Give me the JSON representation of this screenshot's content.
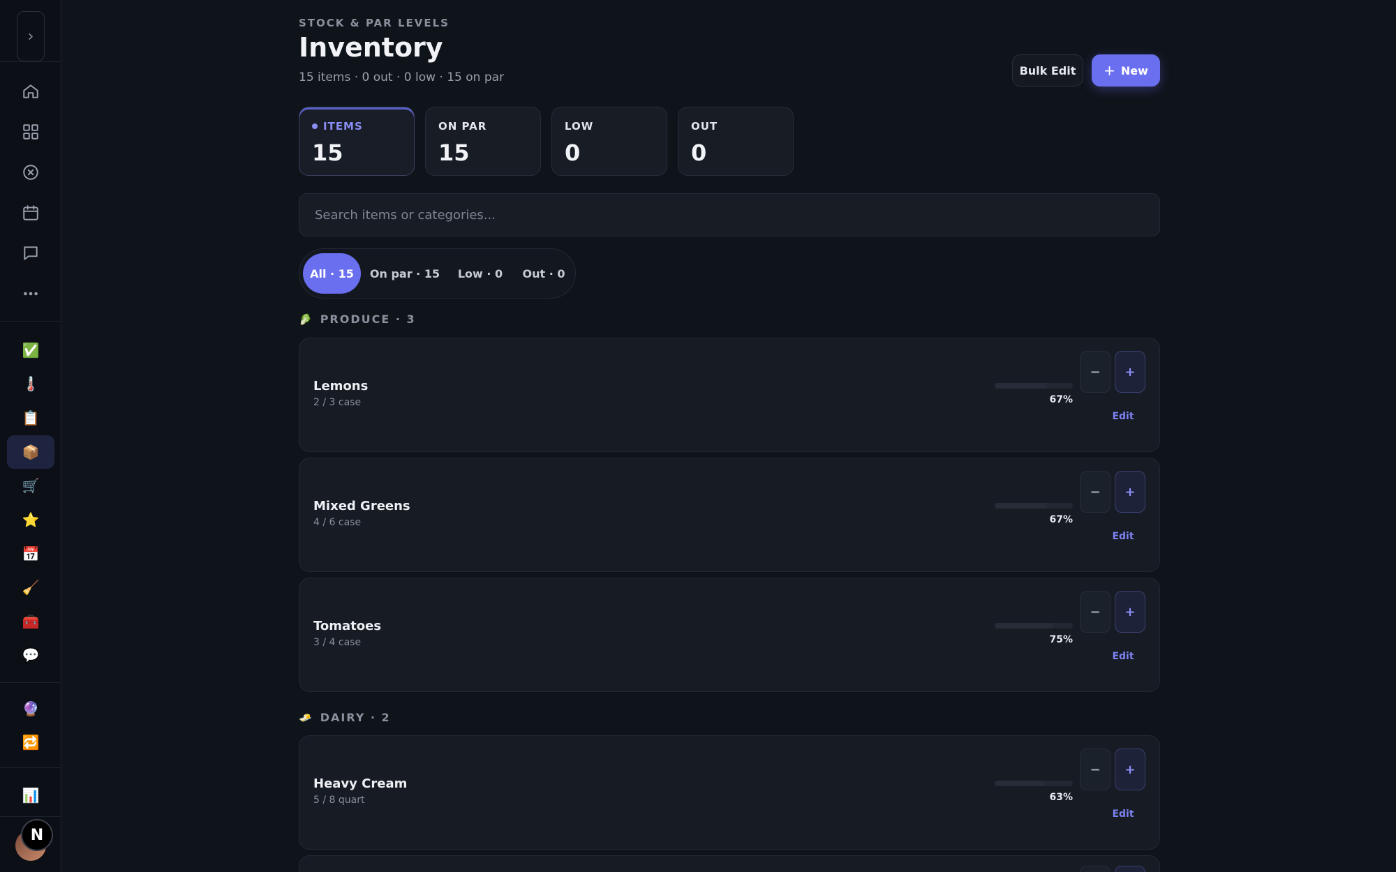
{
  "sidebar": {
    "toggle_glyph": "›",
    "nav_icons": [
      "home-icon",
      "grid-icon",
      "cancel-circle-icon",
      "calendar-icon",
      "chat-icon",
      "more-icon"
    ],
    "app_items": [
      {
        "icon": "✅",
        "name": "checklist-app"
      },
      {
        "icon": "🌡️",
        "name": "thermometer-app"
      },
      {
        "icon": "📋",
        "name": "clipboard-app"
      },
      {
        "icon": "📦",
        "name": "inventory-app"
      },
      {
        "icon": "🛒",
        "name": "cart-app"
      },
      {
        "icon": "⭐",
        "name": "star-app"
      },
      {
        "icon": "📅",
        "name": "calendar-app"
      },
      {
        "icon": "🧹",
        "name": "cleaning-app"
      },
      {
        "icon": "🧰",
        "name": "toolbox-app"
      },
      {
        "icon": "💬",
        "name": "messages-app"
      },
      {
        "icon": "🔮",
        "name": "crystal-ball-app"
      },
      {
        "icon": "🔁",
        "name": "repeat-app"
      },
      {
        "icon": "📊",
        "name": "reports-app"
      }
    ],
    "badge_letter": "N"
  },
  "header": {
    "eyebrow": "STOCK & PAR LEVELS",
    "title": "Inventory",
    "subtitle": "15 items · 0 out · 0 low · 15 on par",
    "bulk_edit_label": "Bulk Edit",
    "new_label": "New",
    "new_icon": "+"
  },
  "stats": [
    {
      "label": "ITEMS",
      "value": "15"
    },
    {
      "label": "ON PAR",
      "value": "15"
    },
    {
      "label": "LOW",
      "value": "0"
    },
    {
      "label": "OUT",
      "value": "0"
    }
  ],
  "search": {
    "placeholder": "Search items or categories...",
    "value": ""
  },
  "tabs": [
    "All · 15",
    "On par · 15",
    "Low · 0",
    "Out · 0"
  ],
  "sections": [
    {
      "icon": "🥬",
      "title": "PRODUCE · 3",
      "items": [
        {
          "name": "Lemons",
          "qty": "2 / 3 case",
          "pct": "67%",
          "fill": 0.67
        },
        {
          "name": "Mixed Greens",
          "qty": "4 / 6 case",
          "pct": "67%",
          "fill": 0.67
        },
        {
          "name": "Tomatoes",
          "qty": "3 / 4 case",
          "pct": "75%",
          "fill": 0.75
        }
      ]
    },
    {
      "icon": "🧈",
      "title": "DAIRY · 2",
      "items": [
        {
          "name": "Heavy Cream",
          "qty": "5 / 8 quart",
          "pct": "63%",
          "fill": 0.63
        }
      ]
    }
  ],
  "row_controls": {
    "minus": "−",
    "plus": "+",
    "edit": "Edit"
  },
  "colors": {
    "accent": "#6a6ff0",
    "background": "#0f131a",
    "card": "#161b24"
  }
}
